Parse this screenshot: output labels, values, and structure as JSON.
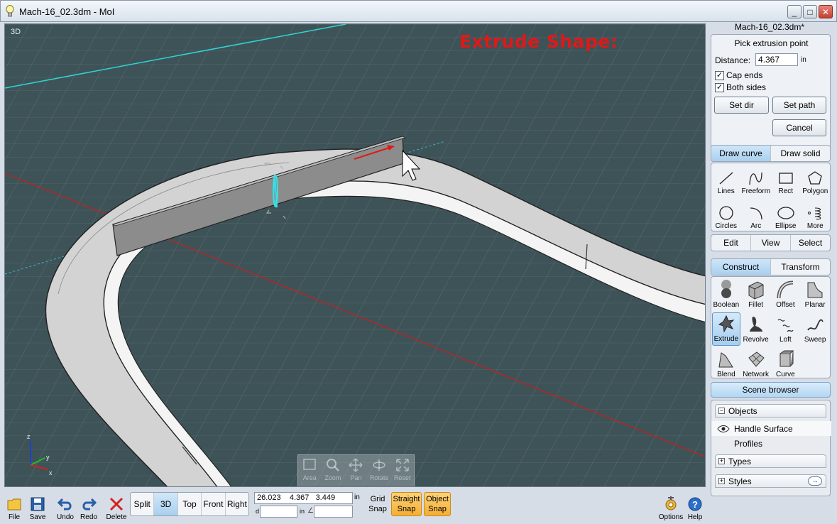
{
  "window": {
    "title": "Mach-16_02.3dm - MoI",
    "minimize": "_",
    "maximize": "□",
    "close": "✕"
  },
  "viewport": {
    "label": "3D",
    "overlay_text": "Extrude Shape:",
    "nav_tools": [
      {
        "label": "Area",
        "icon": "area-zoom-icon"
      },
      {
        "label": "Zoom",
        "icon": "magnifier-icon"
      },
      {
        "label": "Pan",
        "icon": "pan-arrows-icon"
      },
      {
        "label": "Rotate",
        "icon": "rotate-icon"
      },
      {
        "label": "Reset",
        "icon": "reset-view-icon"
      }
    ],
    "axes": {
      "z": "z",
      "y": "y",
      "x": "x"
    }
  },
  "panel": {
    "doc_name": "Mach-16_02.3dm*",
    "command": {
      "prompt": "Pick extrusion point",
      "distance_label": "Distance:",
      "distance_value": "4.367",
      "distance_unit": "in",
      "cap_ends": {
        "label": "Cap ends",
        "checked": true
      },
      "both_sides": {
        "label": "Both sides",
        "checked": true
      },
      "set_dir": "Set dir",
      "set_path": "Set path",
      "cancel": "Cancel"
    },
    "draw_tabs": [
      "Draw curve",
      "Draw solid"
    ],
    "draw_tools": [
      {
        "label": "Lines",
        "icon": "line-icon"
      },
      {
        "label": "Freeform",
        "icon": "freeform-curve-icon"
      },
      {
        "label": "Rect",
        "icon": "rectangle-icon"
      },
      {
        "label": "Polygon",
        "icon": "polygon-icon"
      },
      {
        "label": "Circles",
        "icon": "circle-icon"
      },
      {
        "label": "Arc",
        "icon": "arc-icon"
      },
      {
        "label": "Ellipse",
        "icon": "ellipse-icon"
      },
      {
        "label": "More",
        "icon": "more-spiral-icon"
      }
    ],
    "mode_tabs": [
      "Edit",
      "View",
      "Select"
    ],
    "construct_tabs": [
      "Construct",
      "Transform"
    ],
    "construct_tools": [
      {
        "label": "Boolean",
        "icon": "boolean-icon"
      },
      {
        "label": "Fillet",
        "icon": "fillet-icon"
      },
      {
        "label": "Offset",
        "icon": "offset-icon"
      },
      {
        "label": "Planar",
        "icon": "planar-icon"
      },
      {
        "label": "Extrude",
        "icon": "extrude-icon",
        "active": true
      },
      {
        "label": "Revolve",
        "icon": "revolve-icon"
      },
      {
        "label": "Loft",
        "icon": "loft-icon"
      },
      {
        "label": "Sweep",
        "icon": "sweep-icon"
      },
      {
        "label": "Blend",
        "icon": "blend-icon"
      },
      {
        "label": "Network",
        "icon": "network-icon"
      },
      {
        "label": "Curve",
        "icon": "curve-icon"
      }
    ],
    "scene_browser": "Scene browser",
    "objects": {
      "header": "Objects",
      "items": [
        "Handle Surface",
        "Profiles"
      ]
    },
    "types": "Types",
    "styles": "Styles"
  },
  "toolbar": {
    "file": "File",
    "save": "Save",
    "undo": "Undo",
    "redo": "Redo",
    "delete": "Delete",
    "views": [
      "Split",
      "3D",
      "Top",
      "Front",
      "Right"
    ],
    "active_view": "3D",
    "coords": "26.023    4.367   3.449",
    "coord_unit": "in",
    "d_label": "d",
    "in_label": "in",
    "angle_symbol": "∠",
    "grid_snap": [
      "Grid",
      "Snap"
    ],
    "straight_snap": [
      "Straight",
      "Snap"
    ],
    "object_snap": [
      "Object",
      "Snap"
    ],
    "options": "Options",
    "help": "Help"
  },
  "colors": {
    "viewport_bg": "#3e5358",
    "accent_red": "#e01818",
    "x_axis": "#c81e1e",
    "y_axis": "#2fd4d4",
    "snap_orange": "#f4ae33",
    "active_blue": "#a9cfee"
  }
}
